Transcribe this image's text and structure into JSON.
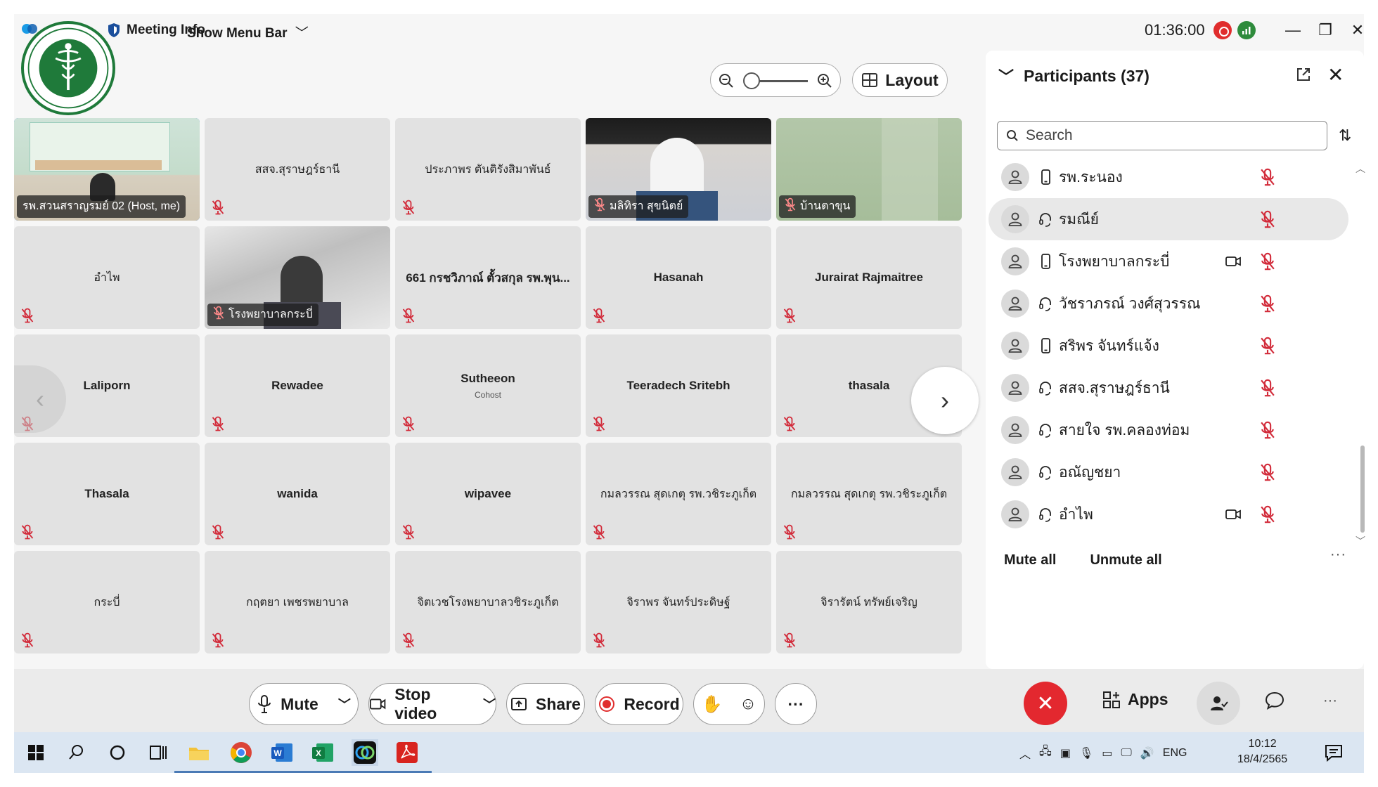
{
  "topbar": {
    "meeting_info": "Meeting Info",
    "show_menu_bar": "Show Menu Bar",
    "timer": "01:36:00"
  },
  "layout_label": "Layout",
  "tiles": [
    {
      "name": "รพ.สวนสราญรมย์ 02 (Host, me)",
      "video": true,
      "active": true
    },
    {
      "name": "สสจ.สุราษฎร์ธานี",
      "thai": true
    },
    {
      "name": "ประภาพร ตันติรังสิมาพันธ์",
      "thai": true
    },
    {
      "name": "มลิทิรา สุขนิตย์",
      "video": true
    },
    {
      "name": "บ้านตาขุน",
      "video": true
    },
    {
      "name": "อำไพ",
      "thai": true
    },
    {
      "name": "โรงพยาบาลกระบี่",
      "video": true
    },
    {
      "name": "661 กรชวิภาณ์ ตั้วสกุล รพ.พุน...",
      "thai": false
    },
    {
      "name": "Hasanah"
    },
    {
      "name": "Jurairat Rajmaitree"
    },
    {
      "name": "Laliporn"
    },
    {
      "name": "Rewadee"
    },
    {
      "name": "Sutheeon",
      "sub": "Cohost"
    },
    {
      "name": "Teeradech Sritebh"
    },
    {
      "name": "thasala"
    },
    {
      "name": "Thasala"
    },
    {
      "name": "wanida"
    },
    {
      "name": "wipavee"
    },
    {
      "name": "กมลวรรณ สุดเกตุ รพ.วชิระภูเก็ต",
      "thai": true
    },
    {
      "name": "กมลวรรณ สุดเกตุ รพ.วชิระภูเก็ต",
      "thai": true
    },
    {
      "name": "กระบี่",
      "thai": true
    },
    {
      "name": "กฤตยา เพชรพยาบาล",
      "thai": true
    },
    {
      "name": "จิตเวชโรงพยาบาลวชิระภูเก็ต",
      "thai": true
    },
    {
      "name": "จิราพร จันทร์ประดิษฐ์",
      "thai": true
    },
    {
      "name": "จิรารัตน์ ทรัพย์เจริญ",
      "thai": true
    }
  ],
  "participants": {
    "title": "Participants (37)",
    "search_placeholder": "Search",
    "items": [
      {
        "name": "รพ.ระนอง",
        "device": "phone",
        "video": false
      },
      {
        "name": "รมณีย์",
        "device": "headset",
        "video": false,
        "hover": true
      },
      {
        "name": "โรงพยาบาลกระบี่",
        "device": "phone",
        "video": true
      },
      {
        "name": "วัชราภรณ์ วงศ์สุวรรณ",
        "device": "headset",
        "video": false
      },
      {
        "name": "สริพร จันทร์แจ้ง",
        "device": "phone",
        "video": false
      },
      {
        "name": "สสจ.สุราษฎร์ธานี",
        "device": "headset",
        "video": false
      },
      {
        "name": "สายใจ รพ.คลองท่อม",
        "device": "headset",
        "video": false
      },
      {
        "name": "อณัญชยา",
        "device": "headset",
        "video": false
      },
      {
        "name": "อำไพ",
        "device": "headset",
        "video": true
      }
    ],
    "mute_all": "Mute all",
    "unmute_all": "Unmute all"
  },
  "controls": {
    "mute": "Mute",
    "stop_video": "Stop video",
    "share": "Share",
    "record": "Record",
    "apps": "Apps"
  },
  "taskbar": {
    "lang": "ENG",
    "time": "10:12",
    "date": "18/4/2565"
  },
  "colors": {
    "accent_blue": "#1b6fd6",
    "end_red": "#e3282f",
    "record_red": "#e02d2d",
    "logo_green": "#1f7a3a"
  }
}
